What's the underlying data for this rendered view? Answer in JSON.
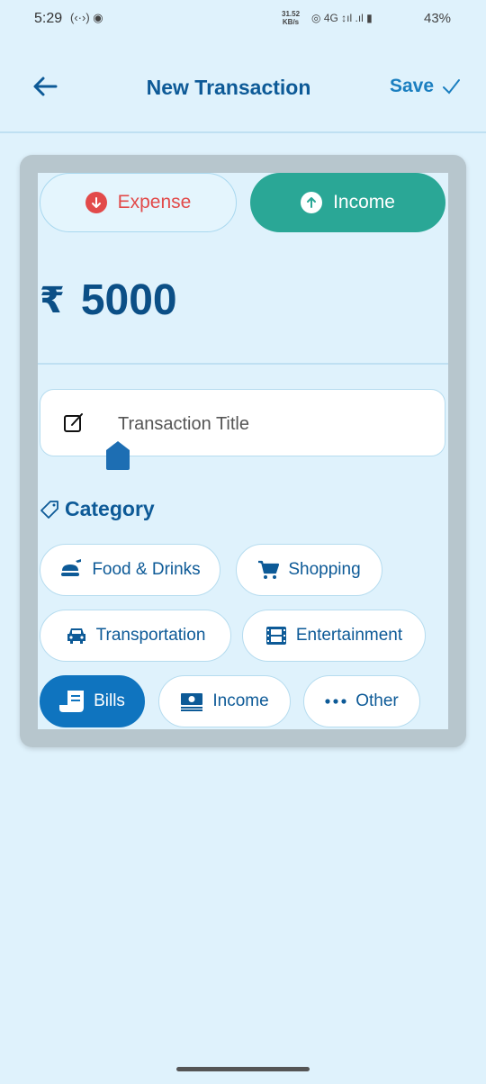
{
  "status_bar": {
    "time": "5:29",
    "speed_value": "31.52",
    "speed_unit": "KB/s",
    "network": "4G",
    "battery": "43%"
  },
  "header": {
    "title": "New Transaction",
    "save_label": "Save"
  },
  "type_toggle": {
    "expense_label": "Expense",
    "income_label": "Income",
    "selected": "income"
  },
  "amount": {
    "currency": "₹",
    "value": "5000"
  },
  "title_field": {
    "placeholder": "Transaction Title"
  },
  "category": {
    "label": "Category",
    "items": [
      {
        "label": "Food & Drinks",
        "icon": "food-icon"
      },
      {
        "label": "Shopping",
        "icon": "cart-icon"
      },
      {
        "label": "Transportation",
        "icon": "car-icon"
      },
      {
        "label": "Entertainment",
        "icon": "film-icon"
      },
      {
        "label": "Bills",
        "icon": "receipt-icon",
        "selected": true
      },
      {
        "label": "Income",
        "icon": "money-icon"
      },
      {
        "label": "Other",
        "icon": "more-icon"
      }
    ]
  },
  "colors": {
    "background": "#dff2fc",
    "primary": "#0d5a97",
    "income_green": "#2aa796",
    "expense_red": "#e24a4a",
    "selected_chip": "#0f74bf"
  }
}
